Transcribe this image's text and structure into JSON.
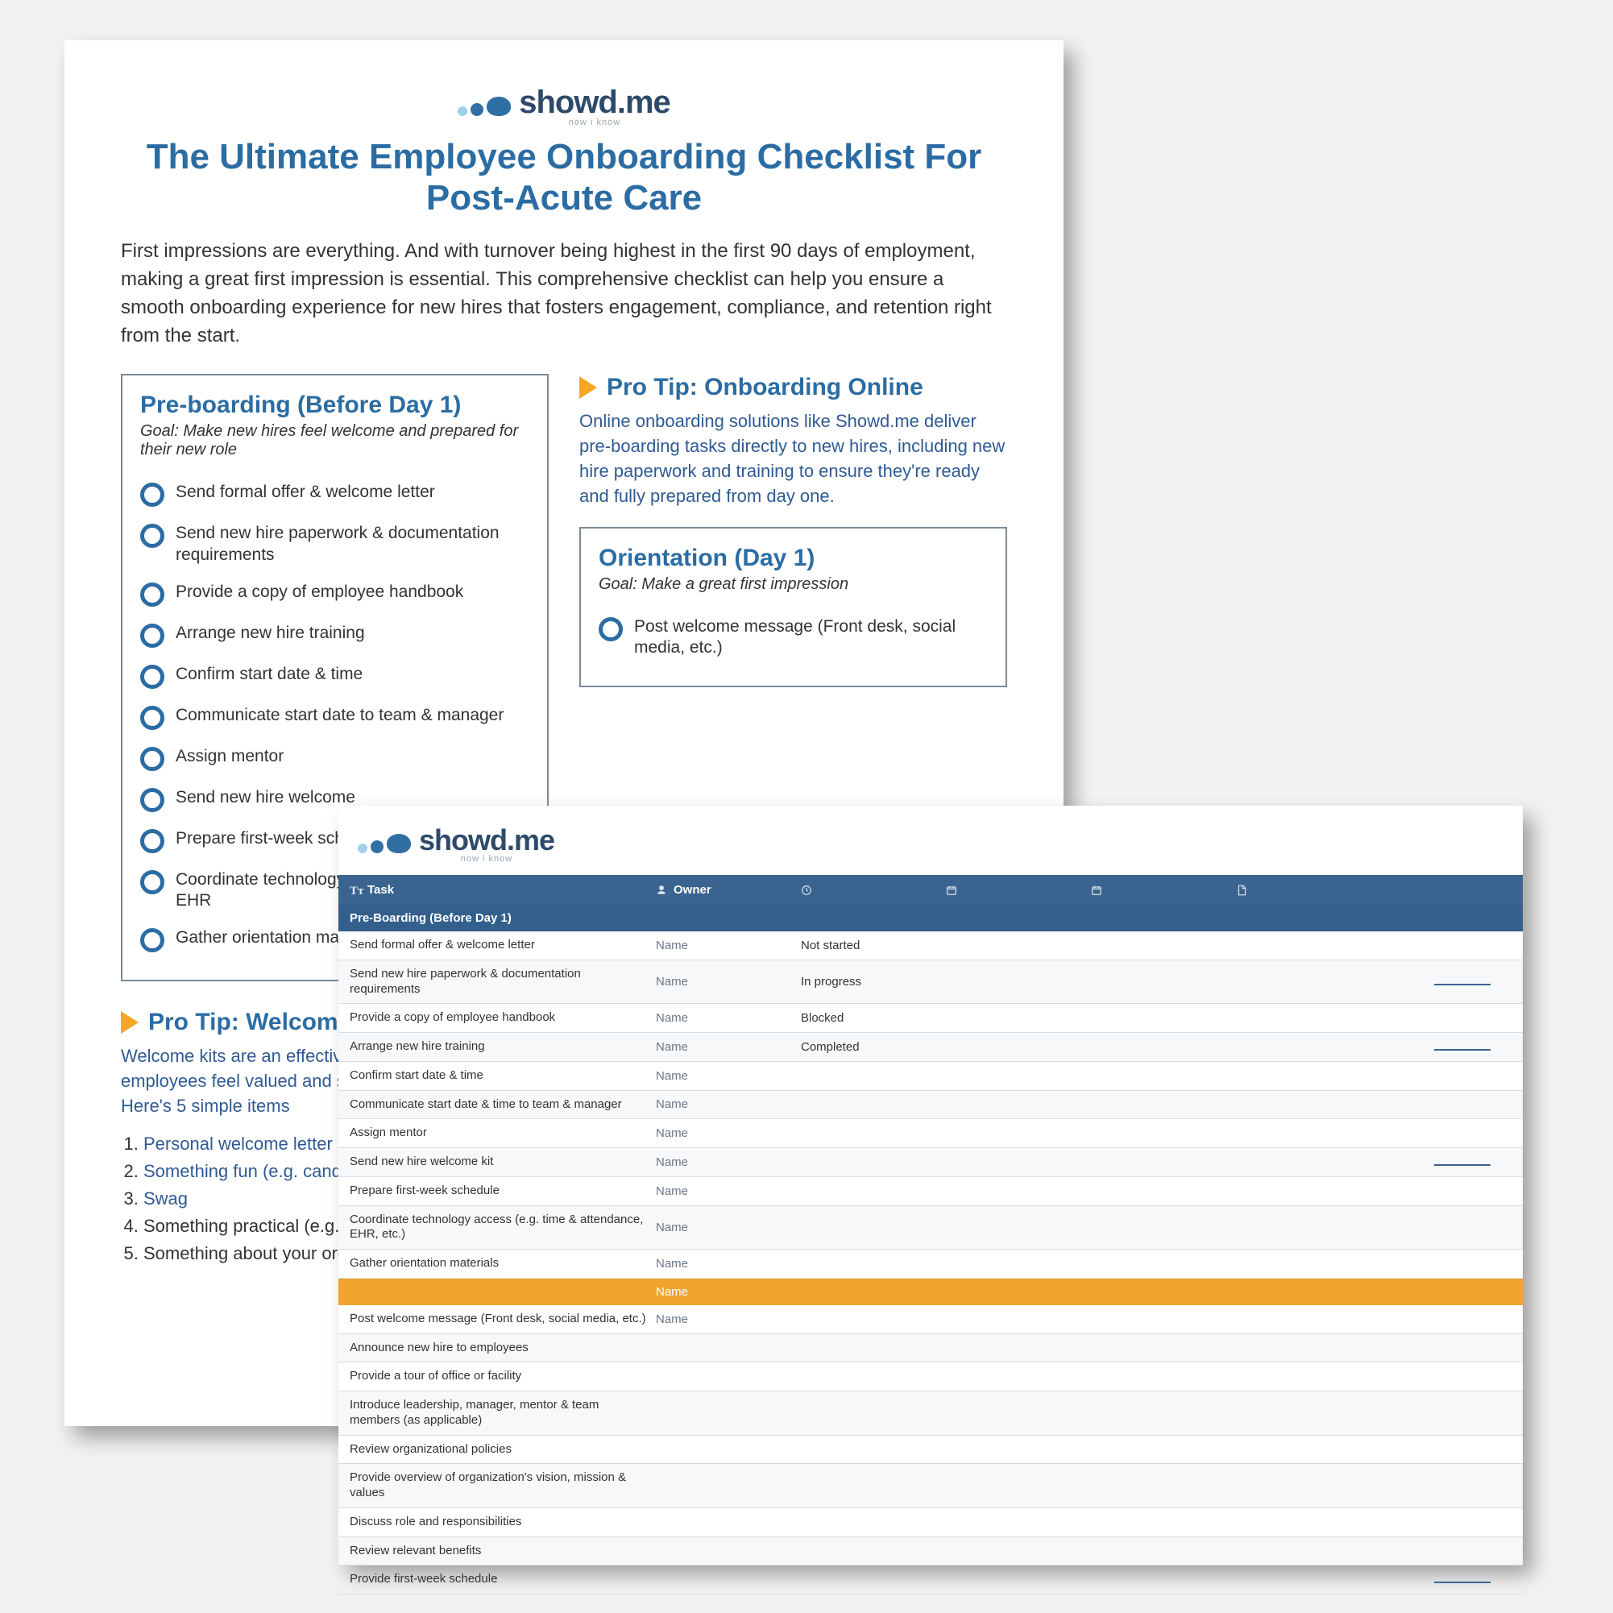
{
  "brand": {
    "name": "showd.me",
    "tagline": "now i know"
  },
  "doc": {
    "title": "The Ultimate Employee Onboarding Checklist For Post-Acute Care",
    "intro": "First impressions are everything. And with turnover being highest in the first 90 days of employment, making a great first impression is essential. This comprehensive checklist can help you ensure a smooth onboarding experience for new hires that fosters engagement, compliance, and retention right from the start.",
    "preboarding": {
      "heading": "Pre-boarding (Before Day 1)",
      "goal": "Goal: Make new hires feel welcome and prepared for their new role",
      "items": [
        "Send formal offer & welcome letter",
        "Send new hire paperwork & documentation requirements",
        "Provide a copy of employee handbook",
        "Arrange new hire training",
        "Confirm start date & time",
        "Communicate start date to team & manager",
        "Assign mentor",
        "Send new hire welcome",
        "Prepare first-week sche",
        "Coordinate technology, time & attendance, EHR",
        "Gather orientation mat"
      ]
    },
    "tip_online": {
      "heading": "Pro Tip: Onboarding Online",
      "body": "Online onboarding solutions like Showd.me deliver pre-boarding tasks directly to new hires, including new hire paperwork and training to ensure they're ready and fully prepared from day one."
    },
    "orientation": {
      "heading": "Orientation (Day 1)",
      "goal": "Goal: Make a great first impression",
      "items": [
        "Post welcome message (Front desk, social media, etc.)"
      ]
    },
    "tip_kit": {
      "heading": "Pro Tip: Welcome K",
      "body": "Welcome kits are an effective way to help new employees feel valued and supported from the start. Here's 5 simple items",
      "list": [
        "Personal welcome letter",
        "Something fun (e.g. candy",
        "Swag",
        "Something practical (e.g. g",
        "Something about your org"
      ]
    }
  },
  "sheet": {
    "columns": {
      "task": "Task",
      "owner": "Owner"
    },
    "owner_placeholder": "Name",
    "sections": [
      {
        "label": "Pre-Boarding (Before Day 1)",
        "style": "navy",
        "rows": [
          {
            "task": "Send formal offer & welcome letter",
            "owner": "Name",
            "status": "Not started",
            "file": false
          },
          {
            "task": "Send new hire paperwork & documentation requirements",
            "owner": "Name",
            "status": "In progress",
            "file": true
          },
          {
            "task": "Provide a copy of employee handbook",
            "owner": "Name",
            "status": "Blocked",
            "file": false
          },
          {
            "task": "Arrange new hire training",
            "owner": "Name",
            "status": "Completed",
            "file": true
          },
          {
            "task": "Confirm start date & time",
            "owner": "Name",
            "status": "",
            "file": false
          },
          {
            "task": "Communicate start date & time to team & manager",
            "owner": "Name",
            "status": "",
            "file": false
          },
          {
            "task": "Assign mentor",
            "owner": "Name",
            "status": "",
            "file": false
          },
          {
            "task": "Send new hire welcome kit",
            "owner": "Name",
            "status": "",
            "file": true
          },
          {
            "task": "Prepare first-week schedule",
            "owner": "Name",
            "status": "",
            "file": false
          },
          {
            "task": "Coordinate technology access (e.g. time & attendance, EHR, etc.)",
            "owner": "Name",
            "status": "",
            "file": false
          },
          {
            "task": "Gather orientation materials",
            "owner": "Name",
            "status": "",
            "file": false
          }
        ]
      },
      {
        "label": "",
        "style": "orange",
        "owner": "Name",
        "rows": [
          {
            "task": "Post welcome message (Front desk, social media, etc.)",
            "owner": "Name",
            "status": "",
            "file": false
          },
          {
            "task": "Announce new hire to employees",
            "owner": "",
            "status": "",
            "file": false
          },
          {
            "task": "Provide a tour of office or facility",
            "owner": "",
            "status": "",
            "file": false
          },
          {
            "task": "Introduce leadership, manager, mentor & team members (as applicable)",
            "owner": "",
            "status": "",
            "file": false
          },
          {
            "task": "Review organizational policies",
            "owner": "",
            "status": "",
            "file": false
          },
          {
            "task": "Provide overview of organization's vision, mission & values",
            "owner": "",
            "status": "",
            "file": false
          },
          {
            "task": "Discuss role and responsibilities",
            "owner": "",
            "status": "",
            "file": false
          },
          {
            "task": "Review relevant benefits",
            "owner": "",
            "status": "",
            "file": false
          },
          {
            "task": "Provide first-week schedule",
            "owner": "",
            "status": "",
            "file": true
          }
        ]
      }
    ]
  }
}
